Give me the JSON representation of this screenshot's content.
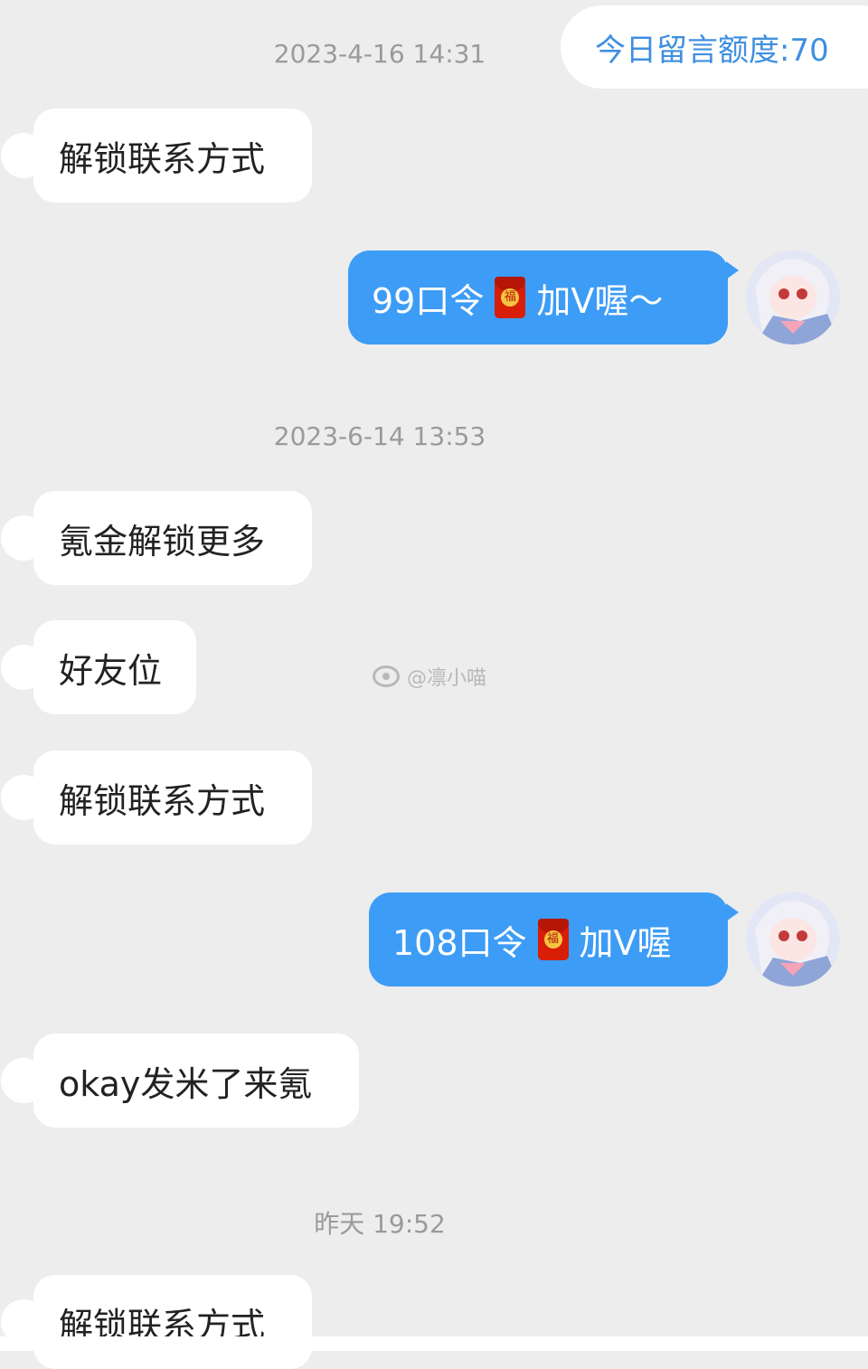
{
  "quota": {
    "label": "今日留言额度:70"
  },
  "timestamps": [
    "2023-4-16 14:31",
    "2023-6-14 13:53",
    "昨天 19:52"
  ],
  "messages": [
    {
      "side": "in",
      "text": "解锁联系方式"
    },
    {
      "side": "out",
      "before": "99口令",
      "after": "加V喔～",
      "sticker": "red-packet-icon"
    },
    {
      "side": "in",
      "text": "氪金解锁更多"
    },
    {
      "side": "in",
      "text": "好友位"
    },
    {
      "side": "in",
      "text": "解锁联系方式"
    },
    {
      "side": "out",
      "before": "108口令",
      "after": "加V喔",
      "sticker": "red-packet-icon"
    },
    {
      "side": "in",
      "text": "okay发米了来氪"
    },
    {
      "side": "in",
      "text": "解锁联系方式"
    }
  ],
  "red_packet_char": "福",
  "watermark": {
    "text": "@凛小喵",
    "icon": "weibo-icon"
  },
  "colors": {
    "background": "#ededed",
    "outgoing_bubble": "#3d9cf5",
    "incoming_bubble": "#ffffff",
    "quota_text": "#3f8fe0",
    "timestamp": "#9a9a9a"
  }
}
